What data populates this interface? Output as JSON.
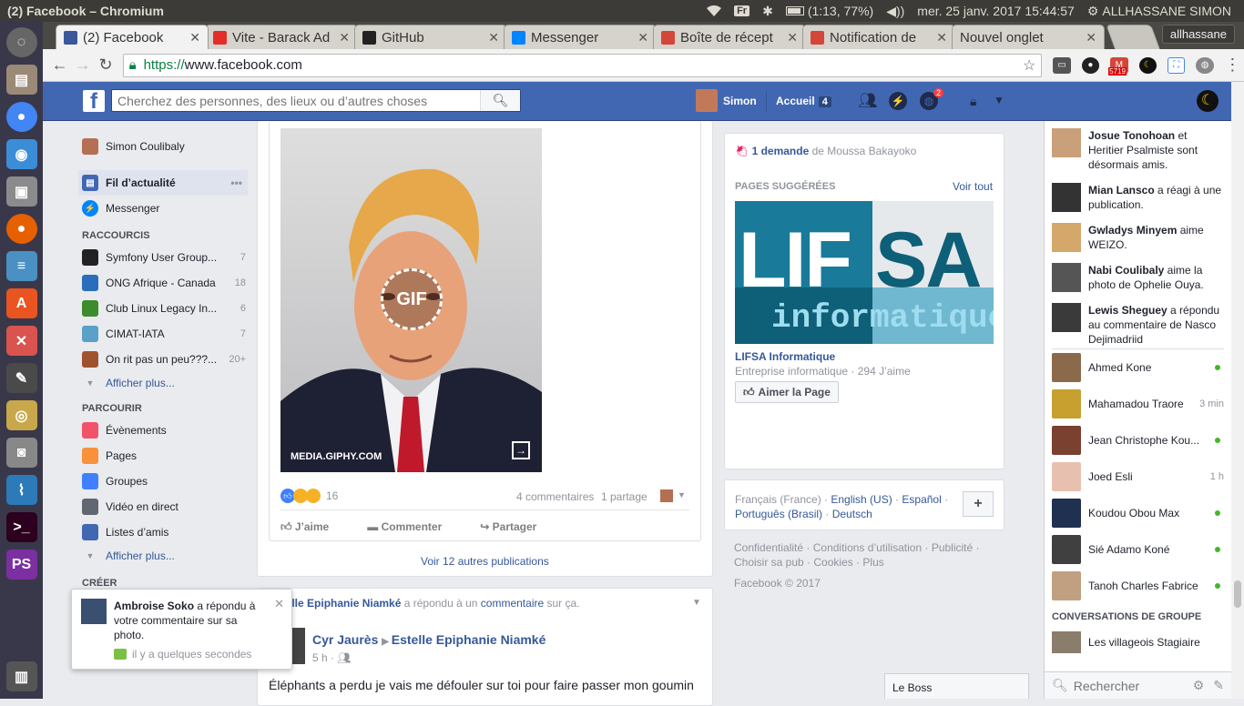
{
  "os": {
    "window_title": "(2) Facebook – Chromium",
    "lang": "Fr",
    "battery": "(1:13, 77%)",
    "datetime": "mer. 25 janv. 2017 15:44:57",
    "username": "ALLHASSANE SIMON"
  },
  "browser": {
    "tabs": [
      {
        "label": "(2) Facebook",
        "icon": "facebook-icon",
        "color": "#3b5998",
        "active": true
      },
      {
        "label": "Vite - Barack Ad",
        "icon": "youtube-icon",
        "color": "#e52d27"
      },
      {
        "label": "GitHub",
        "icon": "github-icon",
        "color": "#222222"
      },
      {
        "label": "Messenger",
        "icon": "messenger-icon",
        "color": "#0084ff"
      },
      {
        "label": "Boîte de récept",
        "icon": "gmail-icon",
        "color": "#d44638"
      },
      {
        "label": "Notification de",
        "icon": "gmail-icon",
        "color": "#d44638"
      },
      {
        "label": "Nouvel onglet",
        "icon": "",
        "color": ""
      }
    ],
    "profile_name": "allhassane",
    "url_scheme": "https://",
    "url_host": "www.facebook.com",
    "gmail_count": "5719"
  },
  "fb": {
    "search_placeholder": "Cherchez des personnes, des lieux ou d’autres choses",
    "profile_name": "Simon",
    "home_label": "Accueil",
    "home_count": "4",
    "notif_count": "2"
  },
  "left": {
    "user": "Simon Coulibaly",
    "news_feed": "Fil d’actualité",
    "messenger": "Messenger",
    "shortcuts_title": "RACCOURCIS",
    "shortcuts": [
      {
        "label": "Symfony User Group...",
        "count": "7",
        "color": "#222"
      },
      {
        "label": "ONG Afrique - Canada",
        "count": "18",
        "color": "#2a6ebb"
      },
      {
        "label": "Club Linux Legacy In...",
        "count": "6",
        "color": "#3c8c2e"
      },
      {
        "label": "CIMAT-IATA",
        "count": "7",
        "color": "#5aa0c8"
      },
      {
        "label": "On rit pas un peu???...",
        "count": "20+",
        "color": "#a0522d"
      }
    ],
    "more1": "Afficher plus...",
    "explore_title": "PARCOURIR",
    "explore": [
      {
        "label": "Évènements",
        "color": "#f35369"
      },
      {
        "label": "Pages",
        "color": "#f7923b"
      },
      {
        "label": "Groupes",
        "color": "#4080ff"
      },
      {
        "label": "Vidéo en direct",
        "color": "#606770"
      },
      {
        "label": "Listes d’amis",
        "color": "#4267b2"
      }
    ],
    "more2": "Afficher plus...",
    "create_title": "CRÉER"
  },
  "post1": {
    "gif_label": "GIF",
    "gif_source": "MEDIA.GIPHY.COM",
    "reactions_count": "16",
    "comments": "4 commentaires",
    "shares": "1 partage",
    "like": "J’aime",
    "comment": "Commenter",
    "share": "Partager",
    "more": "Voir 12 autres publications"
  },
  "post2": {
    "header_name": "Estelle Epiphanie Niamké",
    "header_mid": " a répondu à un ",
    "header_link": "commentaire",
    "header_end": " sur ça.",
    "author": "Cyr Jaurès",
    "target": "Estelle Epiphanie Niamké",
    "time": "5 h ·",
    "text": "Éléphants a perdu je vais me défouler sur toi pour faire passer mon goumin"
  },
  "toast": {
    "name": "Ambroise Soko",
    "text": " a répondu à votre commentaire sur sa photo.",
    "time": "il y a quelques secondes"
  },
  "right": {
    "request_link": "1 demande",
    "request_from": " de Moussa Bakayoko",
    "suggested_title": "PAGES SUGGÉRÉES",
    "see_all": "Voir tout",
    "page_logo_top": "LIF",
    "page_logo_top2": "SA",
    "page_logo_bottom": "informatique",
    "page_name": "LIFSA Informatique",
    "page_meta": "Entreprise informatique · 294 J’aime",
    "like_page": "Aimer la Page",
    "langs": [
      "Français (France)",
      "English (US)",
      "Español",
      "Português (Brasil)",
      "Deutsch"
    ],
    "footer_links": [
      "Confidentialité",
      "Conditions d’utilisation",
      "Publicité",
      "Choisir sa pub",
      "Cookies",
      "Plus"
    ],
    "copyright": "Facebook © 2017",
    "chat_tab": "Le Boss"
  },
  "ticker": [
    {
      "name": "Josue Tonohoan",
      "text": " et Heritier Psalmiste sont désormais amis."
    },
    {
      "name": "Mian Lansco",
      "text": " a réagi à une publication."
    },
    {
      "name": "Gwladys Minyem",
      "text": " aime WEIZO."
    },
    {
      "name": "Nabi Coulibaly",
      "text": " aime la photo de Ophelie Ouya."
    },
    {
      "name": "Lewis Sheguey",
      "text": " a répondu au commentaire de Nasco Dejimadriid"
    }
  ],
  "chat": {
    "contacts": [
      {
        "name": "Ahmed Kone",
        "status": "online"
      },
      {
        "name": "Mahamadou Traore",
        "status": "3 min"
      },
      {
        "name": "Jean Christophe Kou...",
        "status": "online"
      },
      {
        "name": "Joed Esli",
        "status": "1 h"
      },
      {
        "name": "Koudou Obou Max",
        "status": "online"
      },
      {
        "name": "Sié Adamo Koné",
        "status": "online"
      },
      {
        "name": "Tanoh Charles Fabrice",
        "status": "online"
      }
    ],
    "group_title": "CONVERSATIONS DE GROUPE",
    "group_name": "Les villageois Stagiaire",
    "search_placeholder": "Rechercher"
  }
}
